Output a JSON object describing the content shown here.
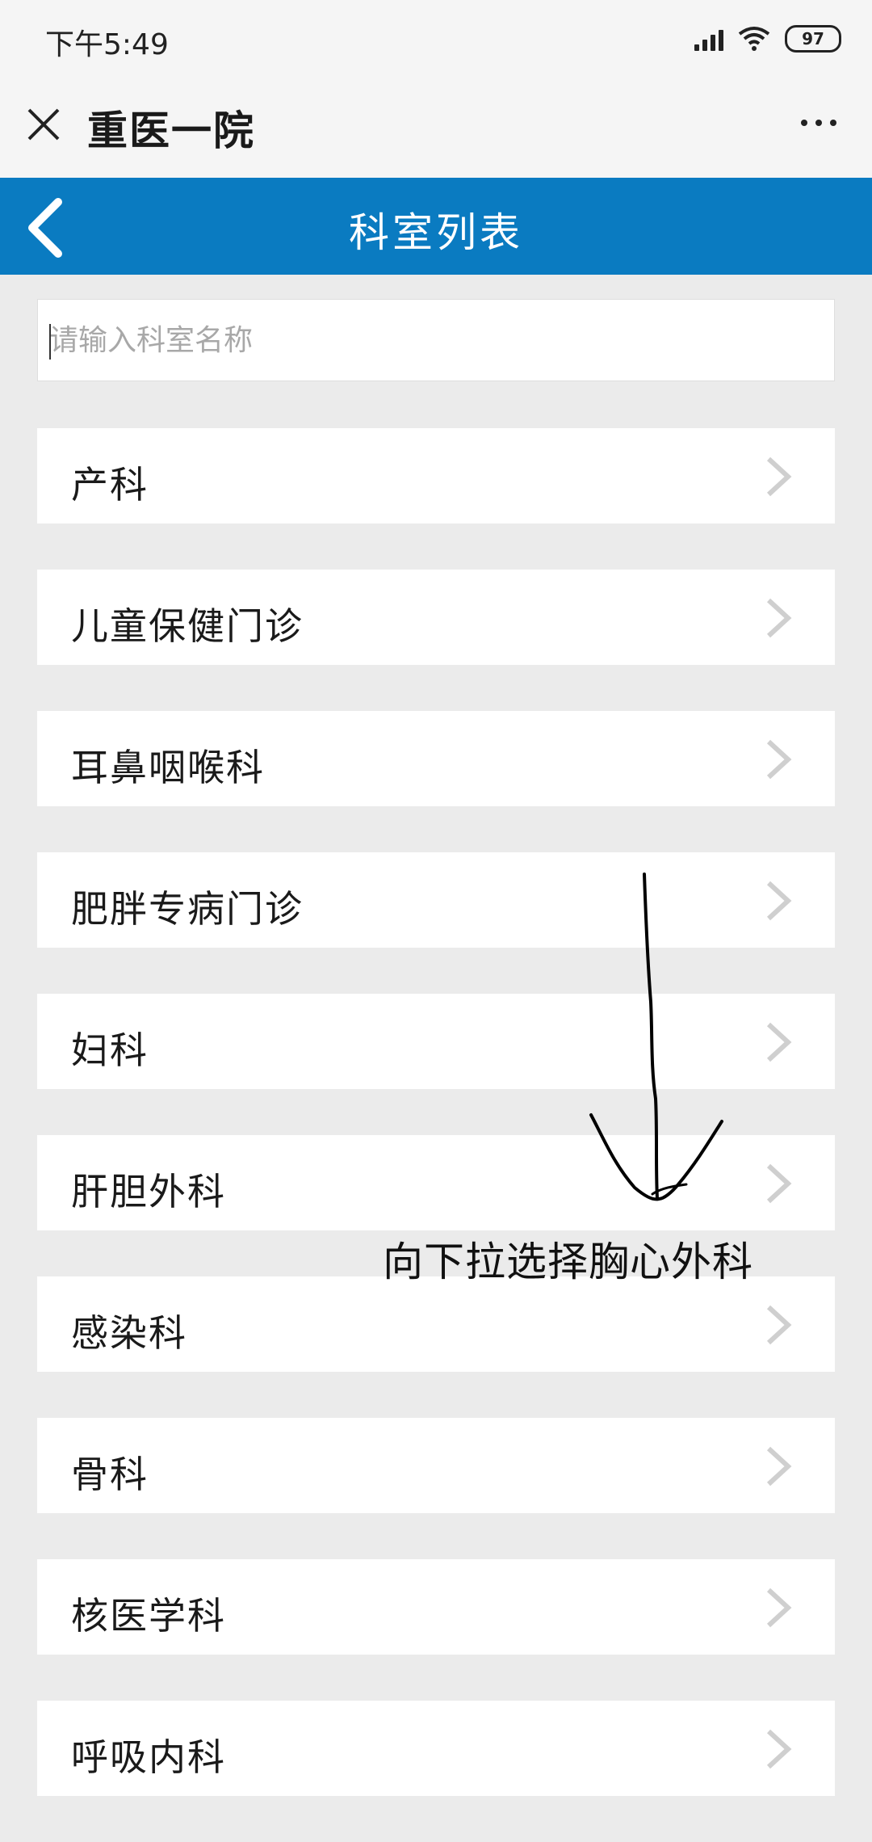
{
  "status_bar": {
    "time": "下午5:49",
    "battery": "97",
    "icons": [
      "signal-icon",
      "wifi-icon",
      "battery-icon"
    ]
  },
  "title_bar": {
    "title": "重医一院",
    "close_icon": "close-icon",
    "more_icon": "more-icon"
  },
  "header": {
    "title": "科室列表",
    "back_icon": "back-icon",
    "color": "#0a7bc1"
  },
  "search": {
    "placeholder": "请输入科室名称",
    "value": ""
  },
  "departments": [
    {
      "label": "产科"
    },
    {
      "label": "儿童保健门诊"
    },
    {
      "label": "耳鼻咽喉科"
    },
    {
      "label": "肥胖专病门诊"
    },
    {
      "label": "妇科"
    },
    {
      "label": "肝胆外科"
    },
    {
      "label": "感染科"
    },
    {
      "label": "骨科"
    },
    {
      "label": "核医学科"
    },
    {
      "label": "呼吸内科"
    }
  ],
  "annotation": {
    "text": "向下拉选择胸心外科"
  }
}
